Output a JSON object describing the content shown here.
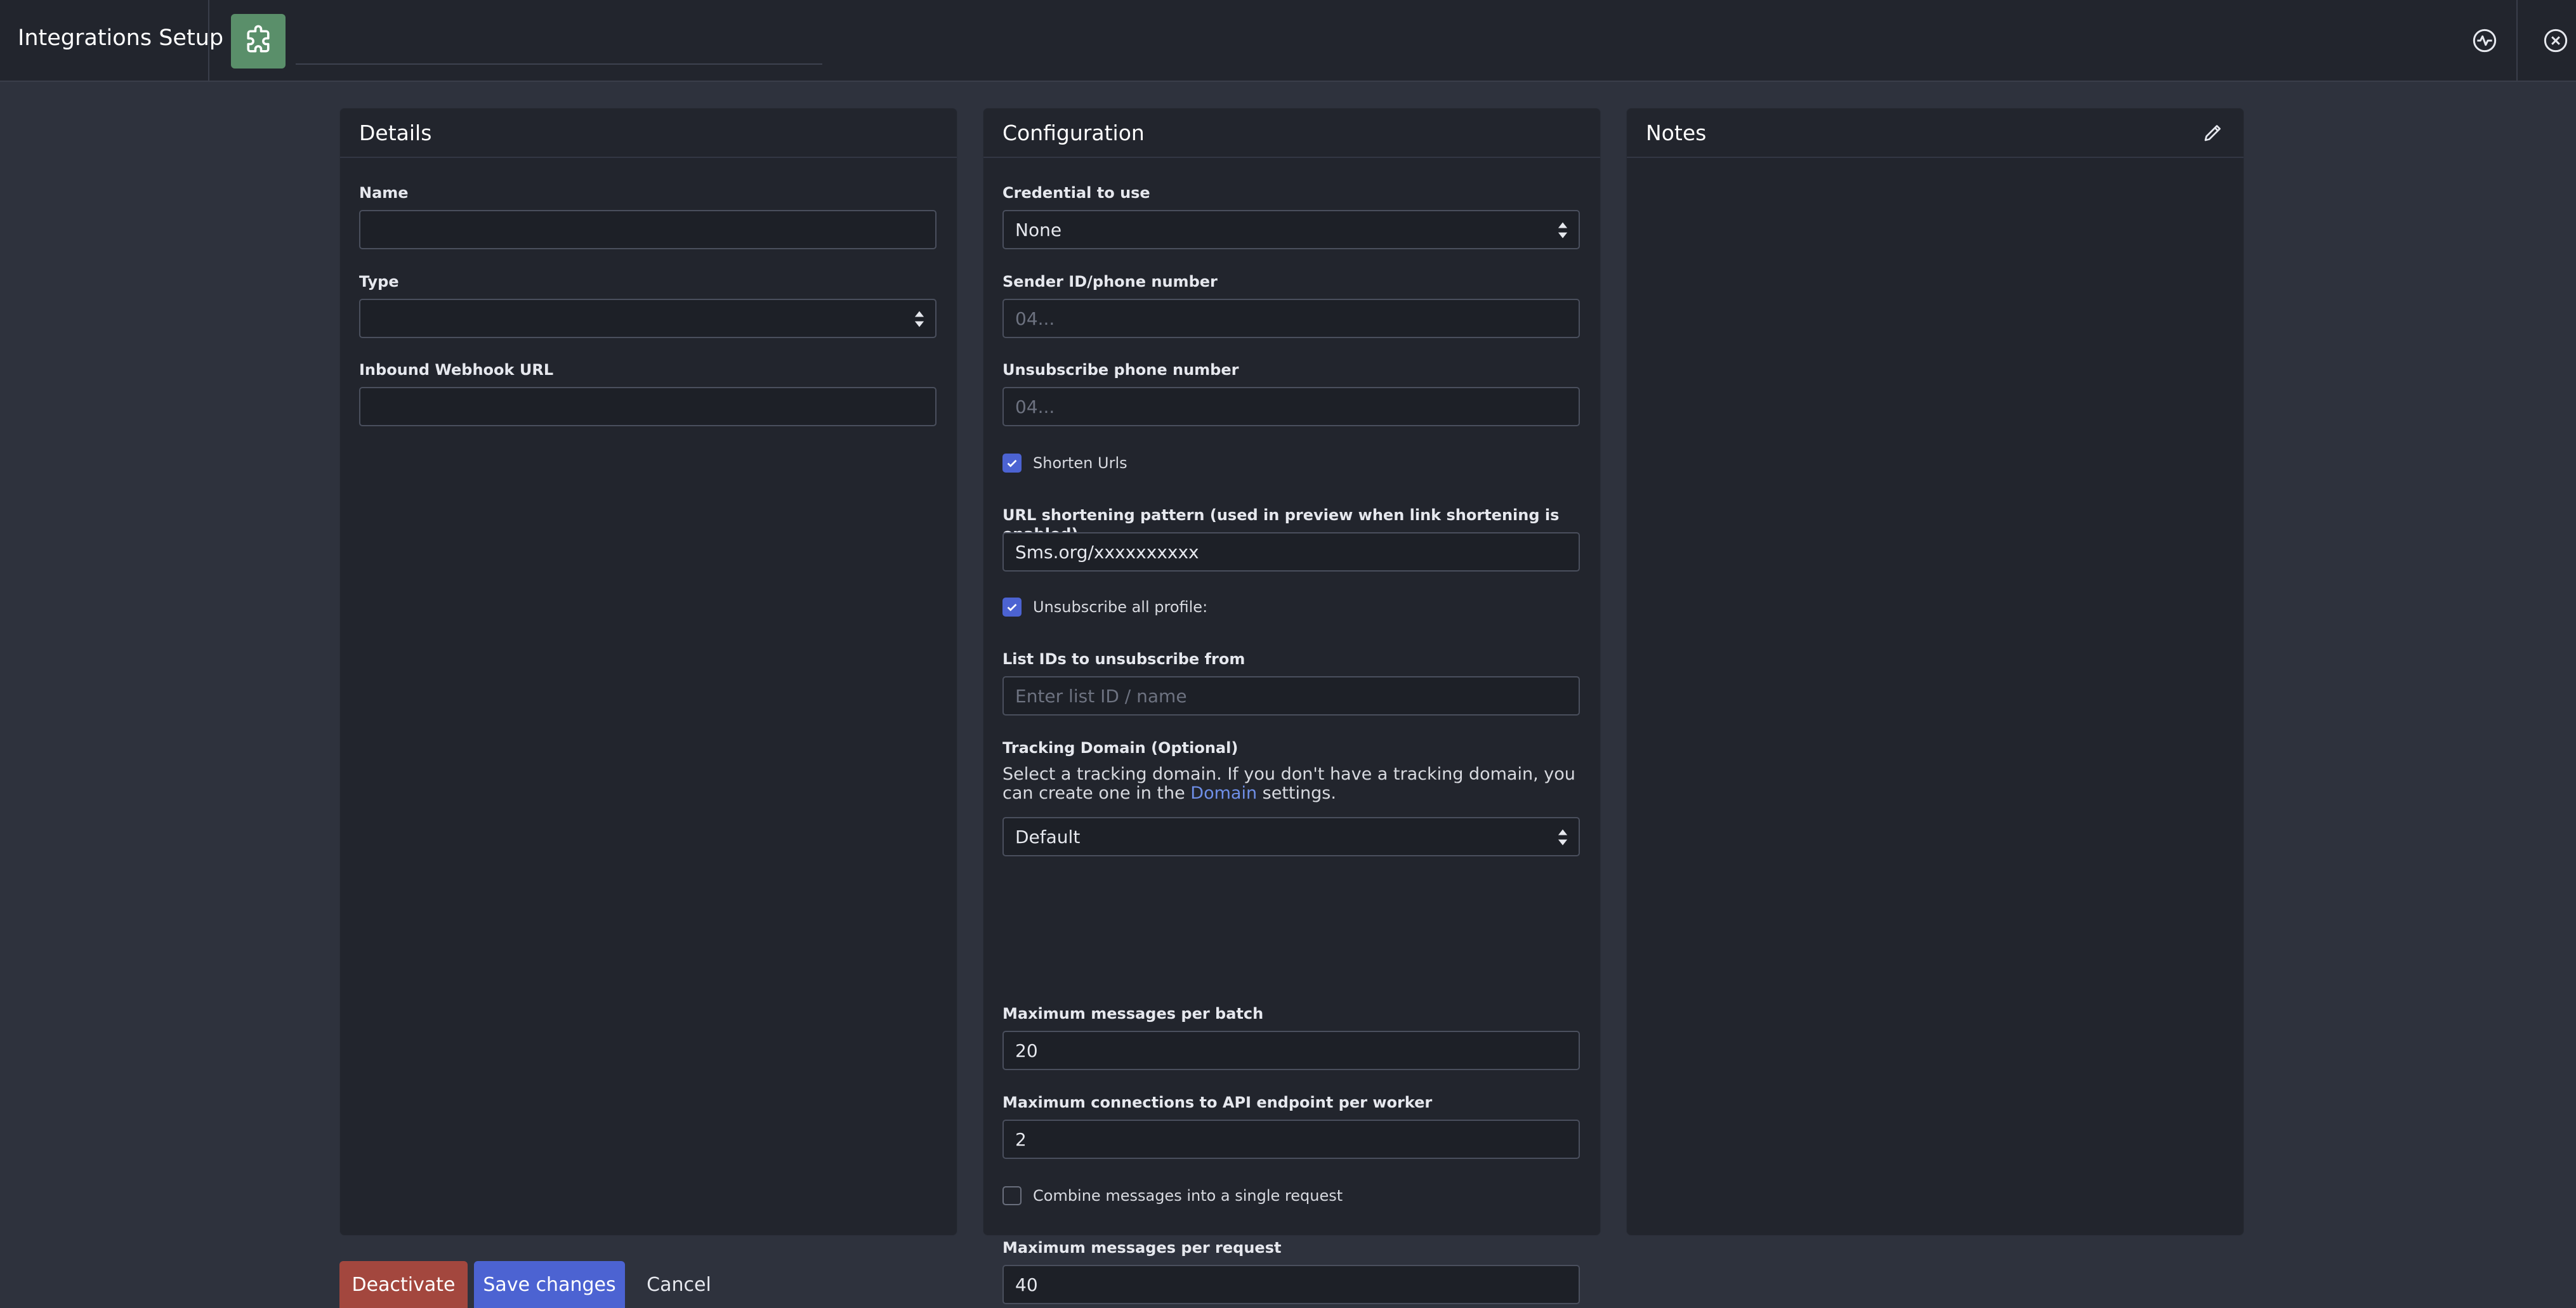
{
  "header": {
    "title": "Integrations Setup",
    "integration_icon": "puzzle-icon",
    "name_value": "",
    "activity_icon": "activity-icon",
    "close_icon": "close-circle-icon"
  },
  "details": {
    "title": "Details",
    "name_label": "Name",
    "name_value": "",
    "type_label": "Type",
    "type_value": "",
    "webhook_label": "Inbound Webhook URL",
    "webhook_value": ""
  },
  "configuration": {
    "title": "Configuration",
    "credential_label": "Credential to use",
    "credential_value": "None",
    "sender_label": "Sender ID/phone number",
    "sender_placeholder": "04...",
    "unsub_phone_label": "Unsubscribe phone number",
    "unsub_phone_placeholder": "04...",
    "shorten_urls_label": "Shorten Urls",
    "shorten_urls_checked": true,
    "url_pattern_label": "URL shortening pattern (used in preview when link shortening is enabled)",
    "url_pattern_value": "Sms.org/xxxxxxxxxx",
    "unsub_all_label": "Unsubscribe all profile:",
    "unsub_all_checked": true,
    "list_ids_label": "List IDs to unsubscribe from",
    "list_ids_placeholder": "Enter list ID / name",
    "tracking_label": "Tracking Domain (Optional)",
    "tracking_help_before": "Select a tracking domain. If you don't have a tracking domain, you can create one in the ",
    "tracking_help_link": "Domain",
    "tracking_help_after": " settings.",
    "tracking_value": "Default",
    "max_batch_label": "Maximum messages per batch",
    "max_batch_value": "20",
    "max_conn_label": "Maximum connections to API endpoint per worker",
    "max_conn_value": "2",
    "combine_label": "Combine messages into a single request",
    "combine_checked": false,
    "max_request_label": "Maximum messages per request",
    "max_request_value": "40"
  },
  "notes": {
    "title": "Notes",
    "edit_icon": "pencil-icon"
  },
  "footer": {
    "deactivate": "Deactivate",
    "save": "Save changes",
    "cancel": "Cancel"
  },
  "colors": {
    "background": "#2e323d",
    "panel": "#22252d",
    "accent": "#4c63d2",
    "danger": "#a3473e",
    "icon_green": "#5a8f6a"
  }
}
